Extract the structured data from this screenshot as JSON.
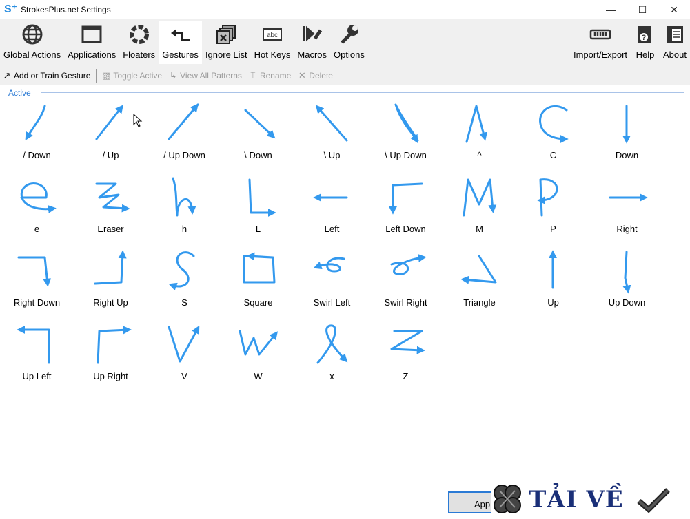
{
  "window": {
    "title": "StrokesPlus.net Settings",
    "controls": [
      "minimize",
      "maximize",
      "close"
    ]
  },
  "ribbon": [
    {
      "label": "Global Actions",
      "icon": "globe-icon"
    },
    {
      "label": "Applications",
      "icon": "window-icon"
    },
    {
      "label": "Floaters",
      "icon": "floaters-ring-icon"
    },
    {
      "label": "Gestures",
      "icon": "gesture-arrow-icon",
      "active": true
    },
    {
      "label": "Ignore List",
      "icon": "ignore-windows-icon"
    },
    {
      "label": "Hot Keys",
      "icon": "keyboard-abc-icon",
      "icon_text": "abc"
    },
    {
      "label": "Macros",
      "icon": "macros-icon"
    },
    {
      "label": "Options",
      "icon": "wrench-icon"
    },
    {
      "label": "Import/Export",
      "icon": "import-export-icon"
    },
    {
      "label": "Help",
      "icon": "help-icon"
    },
    {
      "label": "About",
      "icon": "about-icon"
    }
  ],
  "toolbar": [
    {
      "label": "Add or Train Gesture",
      "enabled": true
    },
    {
      "label": "Toggle Active",
      "enabled": false
    },
    {
      "label": "View All Patterns",
      "enabled": false
    },
    {
      "label": "Rename",
      "enabled": false
    },
    {
      "label": "Delete",
      "enabled": false
    }
  ],
  "group_label": "Active",
  "stroke_color": "#3399ee",
  "gestures": [
    "/ Down",
    "/ Up",
    "/ Up Down",
    "\\ Down",
    "\\ Up",
    "\\ Up Down",
    "^",
    "C",
    "Down",
    "e",
    "Eraser",
    "h",
    "L",
    "Left",
    "Left Down",
    "M",
    "P",
    "Right",
    "Right Down",
    "Right Up",
    "S",
    "Square",
    "Swirl Left",
    "Swirl Right",
    "Triangle",
    "Up",
    "Up Down",
    "Up Left",
    "Up Right",
    "V",
    "W",
    "x",
    "Z"
  ],
  "footer": {
    "apply_label": "App"
  },
  "watermark": {
    "text": "TẢI VỀ"
  }
}
